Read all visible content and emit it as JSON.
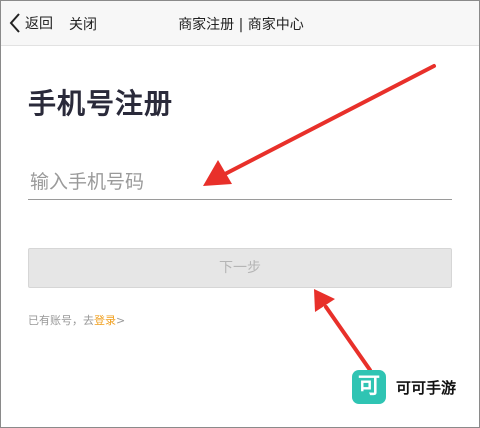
{
  "navbar": {
    "back_label": "返回",
    "close_label": "关闭",
    "title": "商家注册 | 商家中心"
  },
  "form": {
    "title": "手机号注册",
    "phone_placeholder": "输入手机号码",
    "phone_value": "",
    "next_label": "下一步",
    "next_enabled": false,
    "login_prefix": "已有账号，去",
    "login_link": "登录",
    "login_suffix": ">"
  },
  "overlay": {
    "arrow_color": "#e8302a",
    "arrow_count": 2
  },
  "watermark": {
    "logo_char": "可",
    "brand": "可可手游",
    "logo_color": "#2fc4b3"
  },
  "colors": {
    "nav_bg": "#f7f7f7",
    "disabled_button_bg": "#e6e6e6",
    "link": "#f0a020"
  }
}
